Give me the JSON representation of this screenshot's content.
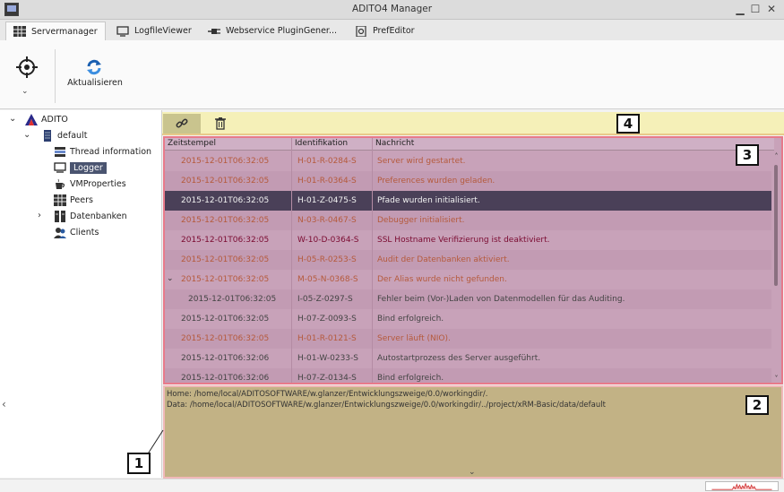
{
  "window": {
    "title": "ADITO4 Manager"
  },
  "tabs": [
    {
      "label": "Servermanager",
      "icon": "grid-icon",
      "active": true
    },
    {
      "label": "LogfileViewer",
      "icon": "monitor-icon",
      "active": false
    },
    {
      "label": "Webservice PluginGener...",
      "icon": "plug-icon",
      "active": false
    },
    {
      "label": "PrefEditor",
      "icon": "gear-doc-icon",
      "active": false
    }
  ],
  "ribbon": {
    "refresh_label": "Aktualisieren"
  },
  "tree": {
    "root": "ADITO",
    "server": "default",
    "items": [
      {
        "label": "Thread information",
        "icon": "threads-icon"
      },
      {
        "label": "Logger",
        "icon": "logger-icon",
        "selected": true
      },
      {
        "label": "VMProperties",
        "icon": "coffee-icon"
      },
      {
        "label": "Peers",
        "icon": "peers-icon"
      },
      {
        "label": "Datenbanken",
        "icon": "database-icon",
        "expandable": true
      },
      {
        "label": "Clients",
        "icon": "clients-icon"
      }
    ]
  },
  "log": {
    "headers": {
      "timestamp": "Zeitstempel",
      "id": "Identifikation",
      "message": "Nachricht"
    },
    "rows": [
      {
        "ts": "2015-12-01T06:32:05",
        "id": "H-01-R-0284-S",
        "msg": "Server wird gestartet.",
        "level": "warn"
      },
      {
        "ts": "2015-12-01T06:32:05",
        "id": "H-01-R-0364-S",
        "msg": "Preferences wurden geladen.",
        "level": "warn"
      },
      {
        "ts": "2015-12-01T06:32:05",
        "id": "H-01-Z-0475-S",
        "msg": "Pfade wurden initialisiert.",
        "level": "sel"
      },
      {
        "ts": "2015-12-01T06:32:05",
        "id": "N-03-R-0467-S",
        "msg": "Debugger initialisiert.",
        "level": "warn"
      },
      {
        "ts": "2015-12-01T06:32:05",
        "id": "W-10-D-0364-S",
        "msg": "SSL Hostname Verifizierung ist deaktiviert.",
        "level": "error"
      },
      {
        "ts": "2015-12-01T06:32:05",
        "id": "H-05-R-0253-S",
        "msg": "Audit der Datenbanken aktiviert.",
        "level": "warn"
      },
      {
        "ts": "2015-12-01T06:32:05",
        "id": "M-05-N-0368-S",
        "msg": "Der Alias wurde nicht gefunden.",
        "level": "warn",
        "expanded": true
      },
      {
        "ts": "2015-12-01T06:32:05",
        "id": "I-05-Z-0297-S",
        "msg": "Fehler beim (Vor-)Laden von Datenmodellen für das Auditing.",
        "level": "info",
        "child": true
      },
      {
        "ts": "2015-12-01T06:32:05",
        "id": "H-07-Z-0093-S",
        "msg": "Bind erfolgreich.",
        "level": "info"
      },
      {
        "ts": "2015-12-01T06:32:05",
        "id": "H-01-R-0121-S",
        "msg": "Server läuft (NIO).",
        "level": "warn"
      },
      {
        "ts": "2015-12-01T06:32:06",
        "id": "H-01-W-0233-S",
        "msg": "Autostartprozess des Server ausgeführt.",
        "level": "info"
      },
      {
        "ts": "2015-12-01T06:32:06",
        "id": "H-07-Z-0134-S",
        "msg": "Bind erfolgreich.",
        "level": "info"
      }
    ]
  },
  "detail": {
    "home": "Home: /home/local/ADITOSOFTWARE/w.glanzer/Entwicklungszweige/0.0/workingdir/.",
    "data": "Data: /home/local/ADITOSOFTWARE/w.glanzer/Entwicklungszweige/0.0/workingdir/../project/xRM-Basic/data/default"
  },
  "callouts": {
    "one": "1",
    "two": "2",
    "three": "3",
    "four": "4"
  },
  "colors": {
    "table_bg": "#c8a2b9",
    "selected_row": "#4a4058",
    "detail_bg": "#c2b285",
    "toolbar_bg": "#f5f0b8",
    "warn_text": "#b55a3c",
    "error_text": "#7a0a30"
  }
}
